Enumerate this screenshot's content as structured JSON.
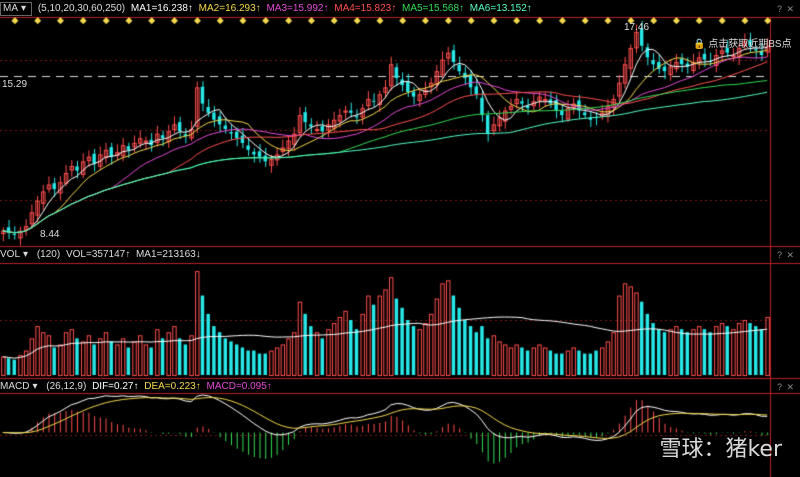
{
  "price_panel": {
    "selector": "MA",
    "params": "(5,10,20,30,60,250)",
    "ma_values": [
      {
        "label": "MA1=16.238↑",
        "color": "#ffffff"
      },
      {
        "label": "MA2=16.293↑",
        "color": "#f5d94c"
      },
      {
        "label": "MA3=15.992↑",
        "color": "#e34bd6"
      },
      {
        "label": "MA4=15.823↑",
        "color": "#ff5050"
      },
      {
        "label": "MA5=15.568↑",
        "color": "#33dd55"
      },
      {
        "label": "MA6=13.152↑",
        "color": "#55ffcc"
      }
    ],
    "high_label": "17.46",
    "low_label": "8.44",
    "price_level": "15.29",
    "bs_label": "点击获取近期BS点"
  },
  "volume_panel": {
    "selector": "VOL",
    "param": "(120)",
    "vol_text": "VOL=357147↑",
    "ma_text": "MA1=213163↓"
  },
  "macd_panel": {
    "selector": "MACD",
    "param": "(26,12,9)",
    "dif_text": "DIF=0.27↑",
    "dea_text": "DEA=0.223↑",
    "macd_text": "MACD=0.095↑"
  },
  "watermark": "雪球：猪ker",
  "help_icon": "?",
  "colors": {
    "up": "#ff4d4d",
    "down": "#27e8e8",
    "ma1": "#ffffff",
    "ma2": "#f5d94c",
    "ma3": "#e34bd6",
    "ma4": "#ff5050",
    "ma5": "#33dd55",
    "ma6": "#55ffcc"
  },
  "chart_data": {
    "type": "candlestick",
    "price_ylim": [
      8.2,
      17.8
    ],
    "annotations": [
      {
        "text": "17.46",
        "value": 17.46
      },
      {
        "text": "8.44",
        "value": 8.44
      }
    ],
    "reference_line": 15.29,
    "close": [
      8.6,
      8.5,
      8.45,
      8.6,
      8.8,
      9.4,
      9.9,
      10.3,
      10.6,
      10.4,
      10.7,
      11.1,
      11.4,
      11.2,
      11.6,
      11.8,
      11.5,
      11.9,
      12.1,
      11.8,
      12.0,
      12.3,
      12.1,
      12.4,
      12.6,
      12.5,
      12.3,
      12.8,
      12.6,
      12.9,
      13.2,
      12.9,
      12.7,
      13.0,
      14.8,
      14.1,
      13.7,
      13.4,
      13.2,
      13.0,
      12.8,
      12.6,
      12.4,
      12.1,
      11.9,
      11.8,
      11.6,
      11.7,
      11.9,
      12.2,
      12.5,
      12.8,
      13.6,
      13.3,
      13.1,
      13.0,
      12.9,
      13.2,
      13.4,
      13.6,
      13.8,
      13.7,
      13.5,
      13.9,
      14.3,
      14.2,
      14.5,
      14.8,
      15.8,
      15.2,
      14.9,
      14.6,
      14.4,
      14.5,
      14.7,
      15.0,
      15.5,
      16.0,
      16.3,
      15.9,
      15.5,
      15.2,
      14.8,
      14.5,
      13.6,
      12.8,
      13.2,
      13.5,
      13.8,
      14.0,
      14.3,
      14.1,
      13.9,
      14.2,
      14.4,
      14.3,
      14.1,
      13.8,
      13.6,
      13.9,
      14.1,
      13.8,
      13.6,
      13.4,
      13.5,
      13.7,
      14.0,
      14.3,
      15.0,
      15.8,
      16.5,
      17.2,
      16.6,
      16.1,
      15.8,
      15.6,
      15.5,
      15.7,
      15.9,
      15.8,
      15.7,
      15.9,
      16.1,
      16.0,
      15.9,
      16.2,
      16.4,
      16.3,
      16.2,
      16.5,
      16.8,
      16.6,
      16.4,
      16.2,
      16.6
    ],
    "volume": [
      60,
      55,
      50,
      65,
      80,
      120,
      160,
      140,
      130,
      90,
      100,
      140,
      150,
      120,
      110,
      130,
      100,
      120,
      140,
      110,
      100,
      120,
      90,
      110,
      130,
      100,
      90,
      150,
      120,
      140,
      160,
      120,
      100,
      130,
      340,
      260,
      200,
      160,
      140,
      120,
      110,
      100,
      90,
      80,
      80,
      70,
      70,
      80,
      90,
      100,
      120,
      140,
      240,
      200,
      160,
      140,
      120,
      150,
      170,
      190,
      210,
      180,
      150,
      200,
      260,
      230,
      260,
      280,
      320,
      250,
      220,
      180,
      160,
      150,
      170,
      200,
      250,
      300,
      310,
      260,
      220,
      180,
      160,
      140,
      160,
      120,
      130,
      110,
      100,
      90,
      100,
      90,
      80,
      90,
      100,
      90,
      80,
      70,
      70,
      80,
      90,
      80,
      70,
      70,
      80,
      90,
      110,
      140,
      260,
      300,
      290,
      270,
      240,
      200,
      170,
      150,
      140,
      150,
      160,
      150,
      140,
      150,
      160,
      150,
      140,
      160,
      170,
      160,
      150,
      170,
      180,
      170,
      160,
      150,
      190
    ],
    "vol_ylim": [
      0,
      360
    ]
  }
}
